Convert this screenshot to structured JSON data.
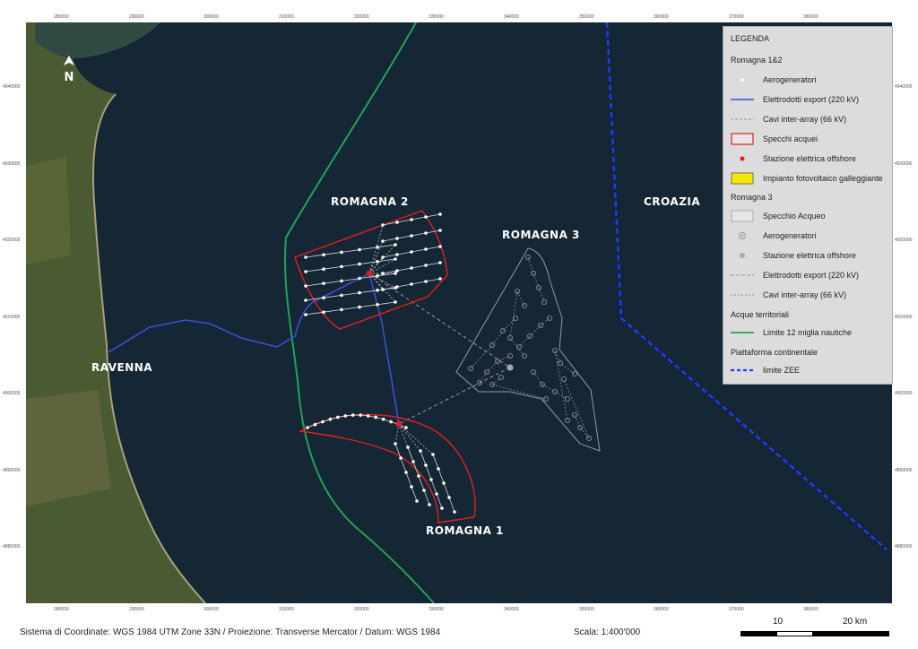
{
  "map": {
    "north_label": "N",
    "labels": {
      "romagna2": "ROMAGNA 2",
      "romagna3": "ROMAGNA 3",
      "romagna1": "ROMAGNA 1",
      "ravenna": "RAVENNA",
      "croazia": "CROAZIA"
    },
    "x_ticks": [
      "280000",
      "290000",
      "300000",
      "310000",
      "320000",
      "330000",
      "340000",
      "350000",
      "360000",
      "370000",
      "380000"
    ],
    "y_ticks": [
      "4940000",
      "4930000",
      "4920000",
      "4910000",
      "4900000",
      "4890000",
      "4880000"
    ],
    "colors": {
      "sea": "#152634",
      "land": "#4a5a32",
      "export_cable": "#3b4fd6",
      "territorial_limit": "#1fa35a",
      "zee_limit": "#1a3cff",
      "water_area_r12": "#e02020",
      "offshore_station": "#e02020",
      "water_area_r3": "#9a9a9a"
    }
  },
  "legend": {
    "title": "LEGENDA",
    "group1": "Romagna 1&2",
    "items1": [
      {
        "icon": "turbine-white-dot-icon",
        "label": "Aerogeneratori"
      },
      {
        "icon": "blue-line-icon",
        "label": "Elettrodotti export (220 kV)"
      },
      {
        "icon": "grey-dashed-line-icon",
        "label": "Cavi inter-array (66 kV)"
      },
      {
        "icon": "red-outline-box-icon",
        "label": "Specchi acquei"
      },
      {
        "icon": "red-dot-icon",
        "label": "Stazione elettrica offshore"
      },
      {
        "icon": "yellow-box-icon",
        "label": "Impianto fotovoltaico galleggiante"
      }
    ],
    "group2": "Romagna 3",
    "items2": [
      {
        "icon": "grey-outline-box-icon",
        "label": "Specchio Acqueo"
      },
      {
        "icon": "grey-ring-dot-icon",
        "label": "Aerogeneratori"
      },
      {
        "icon": "grey-dot-icon",
        "label": "Stazione elettrica offshore"
      },
      {
        "icon": "grey-dashed-line-icon",
        "label": "Elettrodotti export (220 kV)"
      },
      {
        "icon": "grey-dashed-line-icon",
        "label": "Cavi inter-array (66 kV)"
      }
    ],
    "group3": "Acque territoriali",
    "items3": [
      {
        "icon": "green-line-icon",
        "label": "Limite 12 miglia nautiche"
      }
    ],
    "group4": "Piattaforma continentale",
    "items4": [
      {
        "icon": "blue-dashed-line-icon",
        "label": "limite ZEE"
      }
    ]
  },
  "footer": {
    "crs": "Sistema di Coordinate: WGS 1984 UTM Zone 33N / Proiezione: Transverse Mercator / Datum: WGS 1984",
    "scale": "Scala:    1:400'000",
    "scalebar_10": "10",
    "scalebar_20": "20 km"
  }
}
